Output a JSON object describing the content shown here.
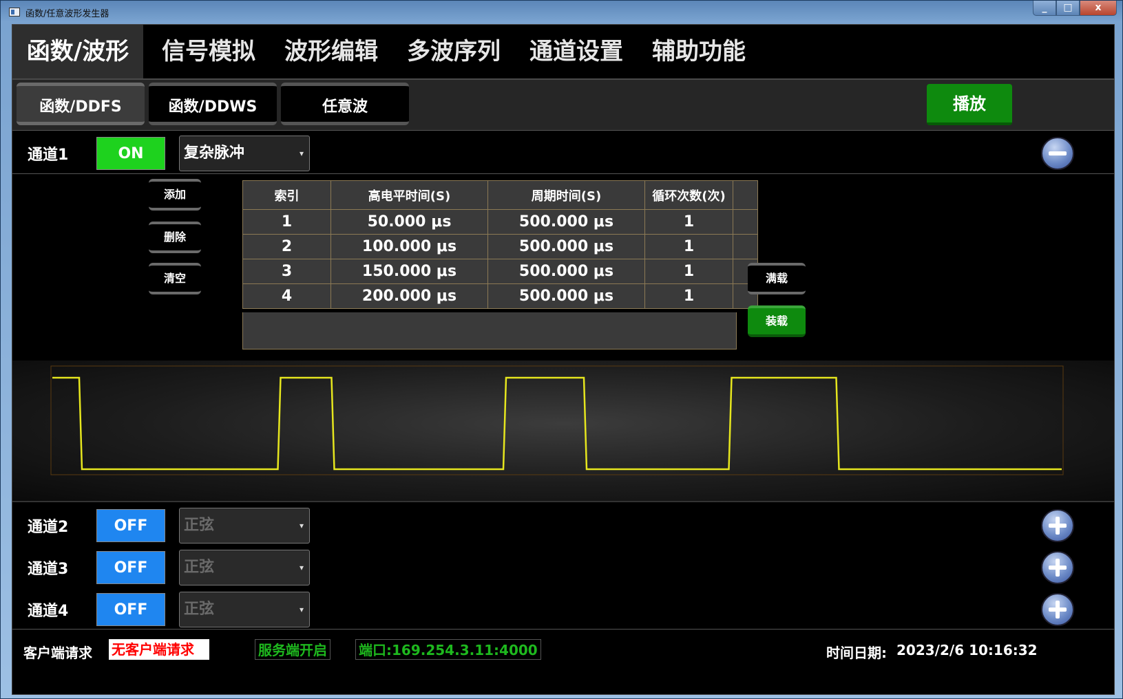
{
  "window": {
    "title": "函数/任意波形发生器",
    "controls": [
      "_",
      "□",
      "x"
    ]
  },
  "tabs": [
    "函数/波形",
    "信号模拟",
    "波形编辑",
    "多波序列",
    "通道设置",
    "辅助功能"
  ],
  "subtabs": [
    "函数/DDFS",
    "函数/DDWS",
    "任意波"
  ],
  "play_label": "播放",
  "channels": [
    {
      "label": "通道1",
      "state": "ON",
      "wave": "复杂脉冲",
      "control": "minus-icon"
    },
    {
      "label": "通道2",
      "state": "OFF",
      "wave": "正弦",
      "control": "plus-icon"
    },
    {
      "label": "通道3",
      "state": "OFF",
      "wave": "正弦",
      "control": "plus-icon"
    },
    {
      "label": "通道4",
      "state": "OFF",
      "wave": "正弦",
      "control": "plus-icon"
    }
  ],
  "editor": {
    "buttons": {
      "add": "添加",
      "delete": "删除",
      "clear": "清空",
      "full_load": "满载",
      "load": "装载"
    },
    "table": {
      "headers": [
        "索引",
        "高电平时间(S)",
        "周期时间(S)",
        "循环次数(次)",
        ""
      ],
      "rows": [
        [
          "1",
          "50.000 μs",
          "500.000 μs",
          "1",
          ""
        ],
        [
          "2",
          "100.000 μs",
          "500.000 μs",
          "1",
          ""
        ],
        [
          "3",
          "150.000 μs",
          "500.000 μs",
          "1",
          ""
        ],
        [
          "4",
          "200.000 μs",
          "500.000 μs",
          "1",
          ""
        ]
      ]
    }
  },
  "waveform": {
    "color": "#e6e61e",
    "pulses": [
      {
        "high_us": 50,
        "period_us": 500
      },
      {
        "high_us": 100,
        "period_us": 500
      },
      {
        "high_us": 150,
        "period_us": 500
      },
      {
        "high_us": 200,
        "period_us": 500
      }
    ]
  },
  "status": {
    "client_label": "客户端请求",
    "client_value": "无客户端请求",
    "server_value": "服务端开启",
    "port_value": "端口:169.254.3.11:4000",
    "datetime_label": "时间日期:",
    "datetime_value": "2023/2/6 10:16:32"
  },
  "colors": {
    "on": "#1ed21e",
    "off": "#1f86f0",
    "play": "#0e8a0e",
    "trace": "#e6e61e"
  }
}
